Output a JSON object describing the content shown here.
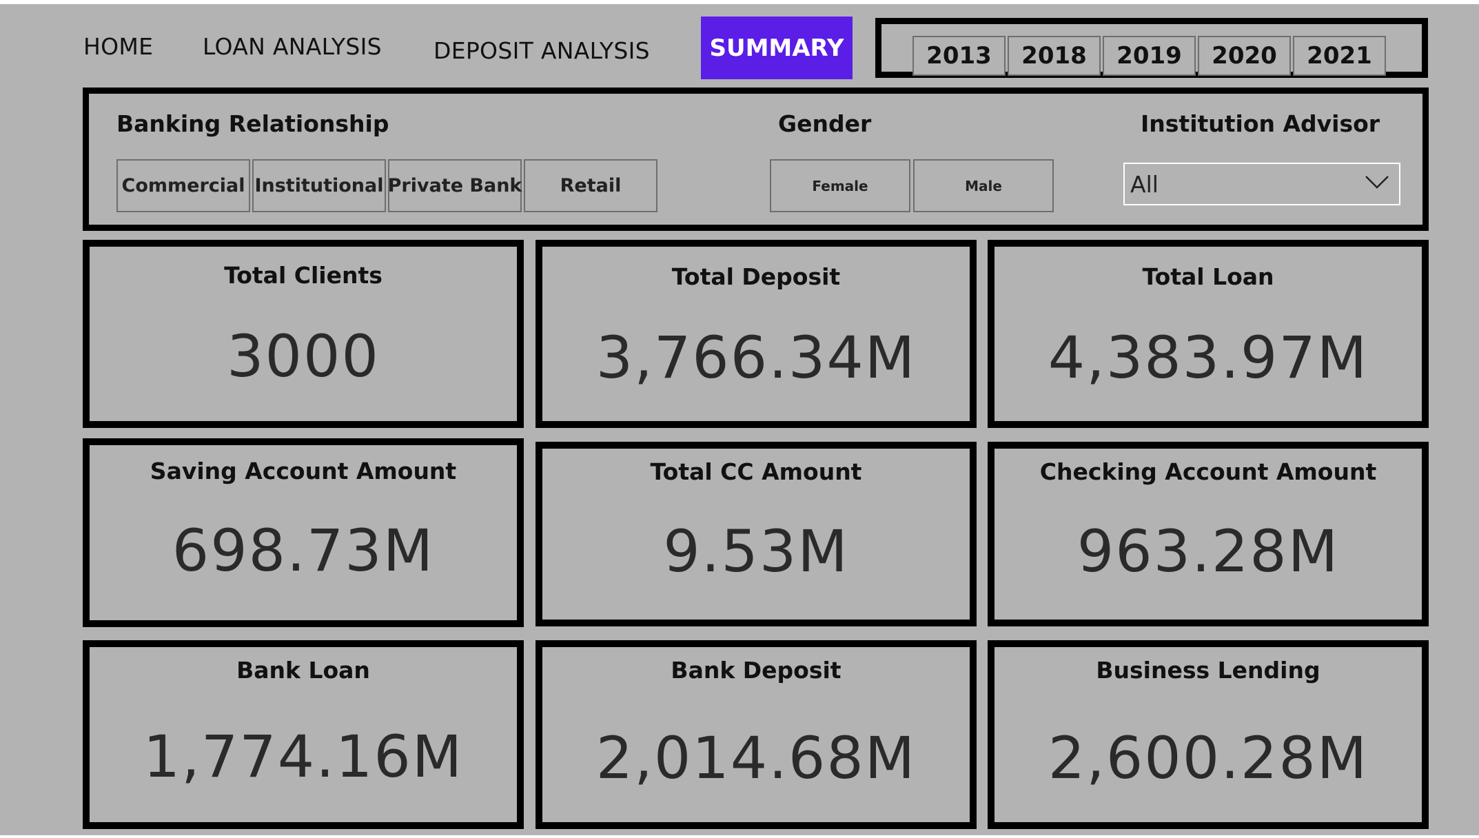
{
  "nav": {
    "home": "HOME",
    "loan_analysis": "LOAN ANALYSIS",
    "deposit_analysis": "DEPOSIT ANALYSIS",
    "summary": "SUMMARY",
    "active_color": "#5b1ee6"
  },
  "years": [
    "2013",
    "2018",
    "2019",
    "2020",
    "2021"
  ],
  "filters": {
    "banking_relationship": {
      "label": "Banking Relationship",
      "options": [
        "Commercial",
        "Institutional",
        "Private Bank",
        "Retail"
      ]
    },
    "gender": {
      "label": "Gender",
      "options": [
        "Female",
        "Male"
      ]
    },
    "institution_advisor": {
      "label": "Institution Advisor",
      "selected": "All",
      "icon": "chevron-down-icon"
    }
  },
  "cards": {
    "total_clients": {
      "title": "Total Clients",
      "value": "3000"
    },
    "total_deposit": {
      "title": "Total Deposit",
      "value": "3,766.34M"
    },
    "total_loan": {
      "title": "Total Loan",
      "value": "4,383.97M"
    },
    "saving_account_amount": {
      "title": "Saving Account Amount",
      "value": "698.73M"
    },
    "total_cc_amount": {
      "title": "Total CC Amount",
      "value": "9.53M"
    },
    "checking_account_amount": {
      "title": "Checking Account Amount",
      "value": "963.28M"
    },
    "bank_loan": {
      "title": "Bank Loan",
      "value": "1,774.16M"
    },
    "bank_deposit": {
      "title": "Bank Deposit",
      "value": "2,014.68M"
    },
    "business_lending": {
      "title": "Business Lending",
      "value": "2,600.28M"
    }
  }
}
